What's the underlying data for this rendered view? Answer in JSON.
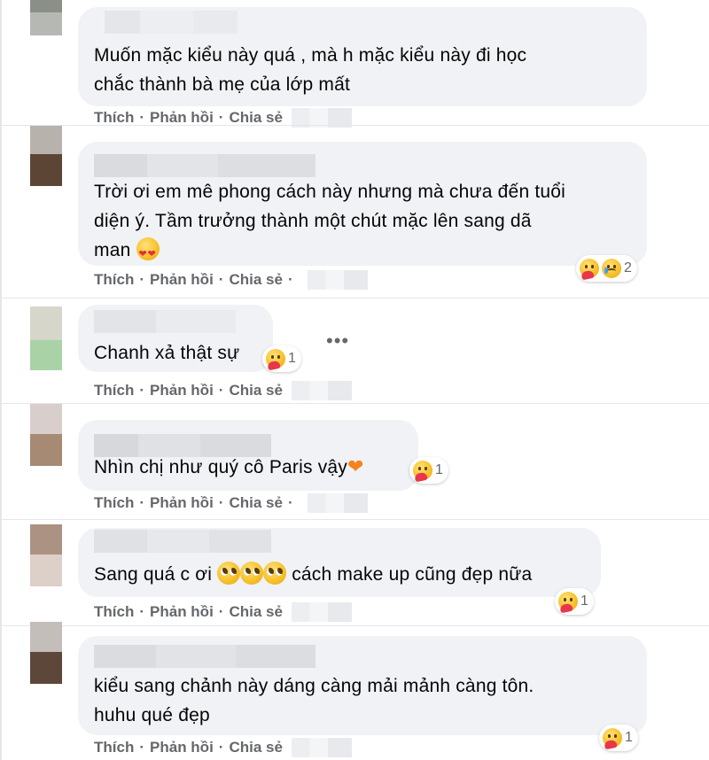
{
  "comments": [
    {
      "text": "Muốn mặc kiểu này quá , mà h mặc kiểu này đi học\nchắc thành bà mẹ của lớp mất"
    },
    {
      "text": "Trời ơi em mê phong cách này nhưng mà chưa đến tuổi\ndiện ý. Tầm trưởng thành một chút mặc lên sang dã\nman ",
      "emoji": "heart-eyes-icon",
      "reaction_count": "2"
    },
    {
      "text": "Chanh xả thật sự",
      "reaction_count": "1"
    },
    {
      "text": "Nhìn chị như quý cô Paris vậy",
      "reaction_count": "1"
    },
    {
      "text_before": "Sang quá c ơi ",
      "text_after": " cách make up cũng đẹp nữa",
      "reaction_count": "1"
    },
    {
      "text": "kiểu sang chảnh này dáng càng mải mảnh càng tôn.\nhuhu qué đẹp",
      "reaction_count": "1"
    }
  ],
  "actions": {
    "like": "Thích",
    "reply": "Phản hồi",
    "share": "Chia sẻ",
    "separator": "·"
  },
  "more_label": "•••",
  "colors": {
    "bubble": "#f0f2f5",
    "action_text": "#65676b",
    "heart": "#f5821f"
  }
}
